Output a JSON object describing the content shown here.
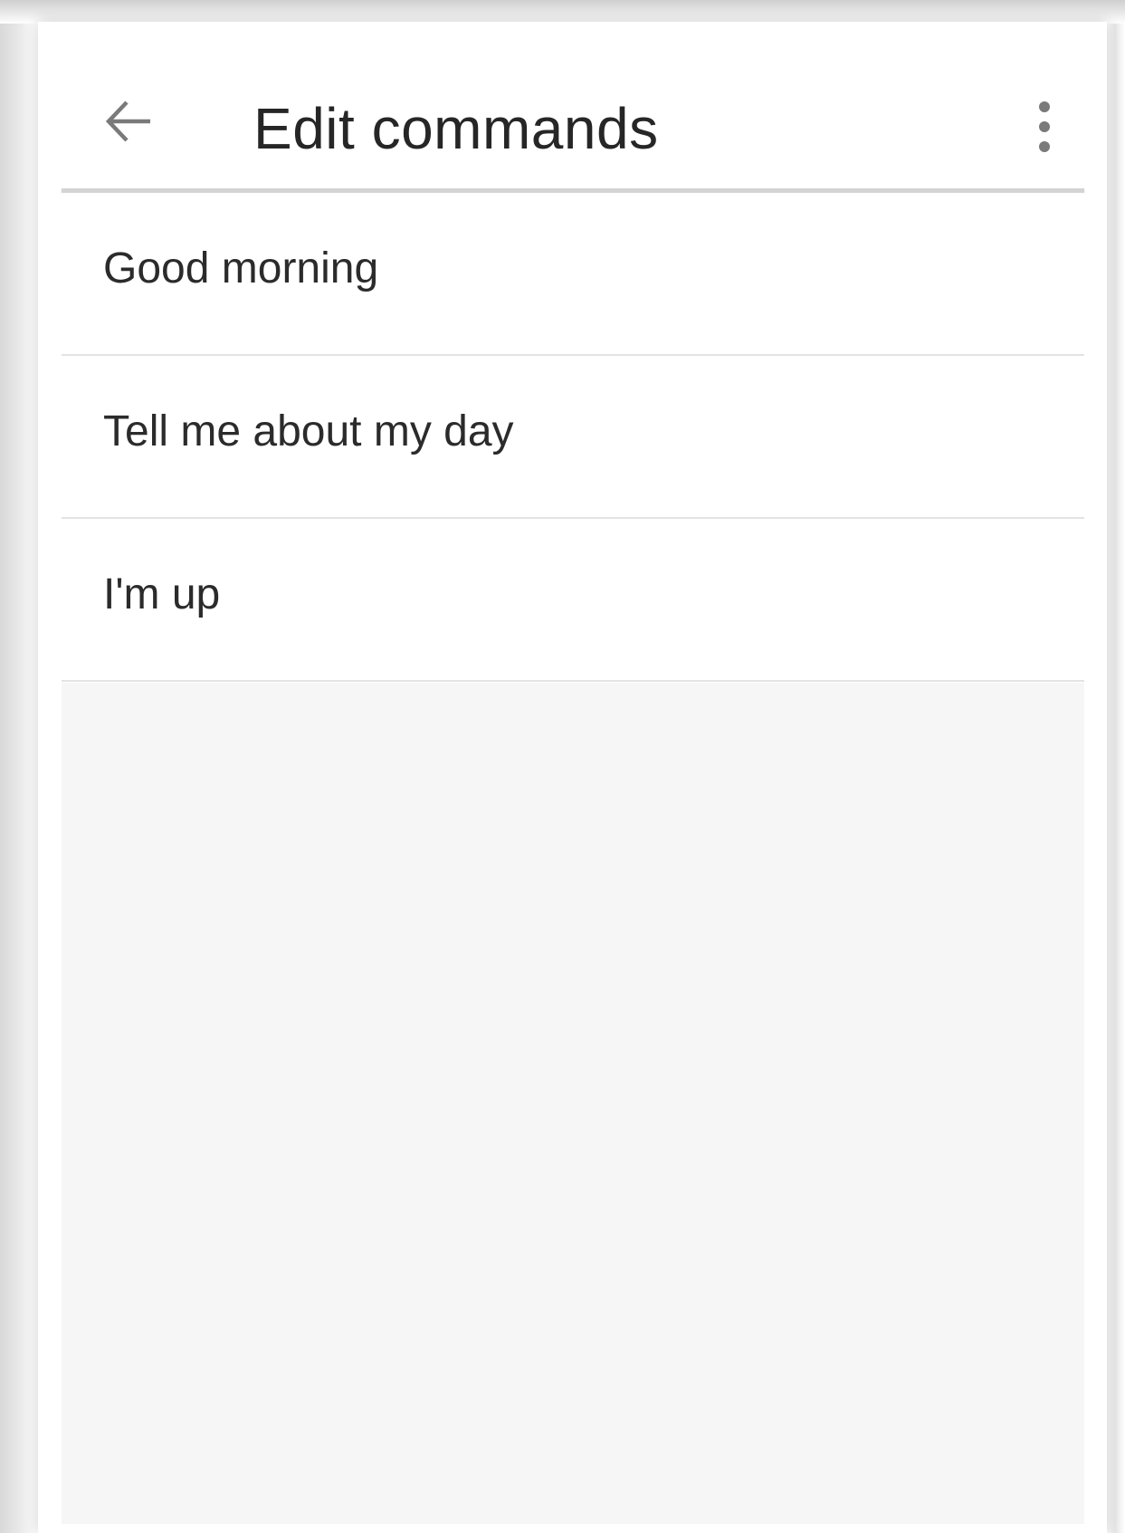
{
  "app_bar": {
    "back_icon": "arrow-back-icon",
    "title": "Edit commands",
    "menu_icon": "more-vert-icon"
  },
  "commands": [
    {
      "label": "Good morning"
    },
    {
      "label": "Tell me about my day"
    },
    {
      "label": "I'm up"
    }
  ],
  "colors": {
    "background": "#ffffff",
    "empty_area": "#f7f6f7",
    "divider": "#e3e3e3",
    "text": "#2b2b2b",
    "icon": "#7a7a7a"
  }
}
